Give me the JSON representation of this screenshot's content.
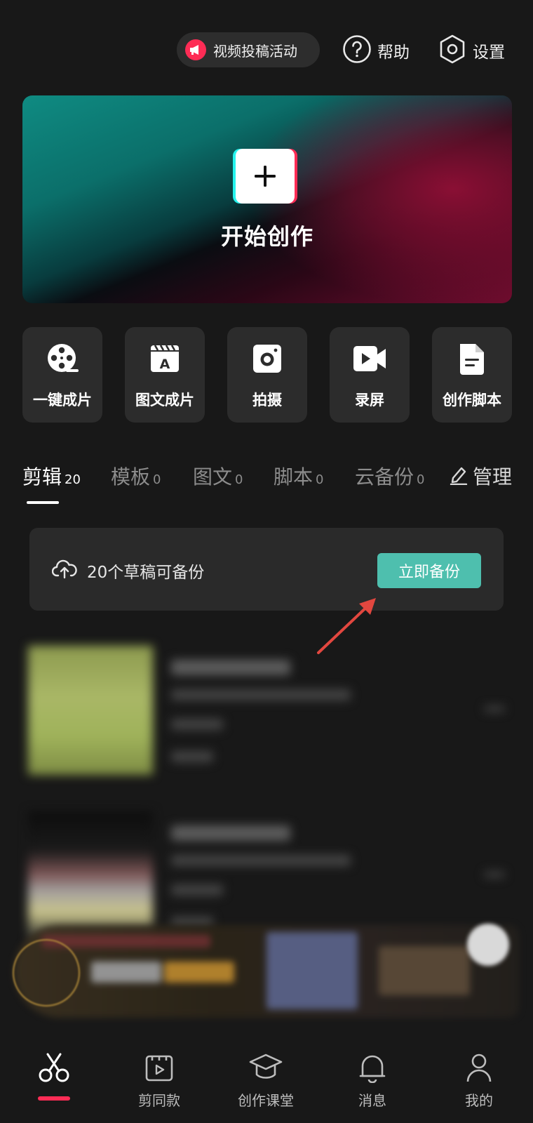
{
  "header": {
    "promo_label": "视频投稿活动",
    "help_label": "帮助",
    "settings_label": "设置"
  },
  "hero": {
    "title": "开始创作"
  },
  "quick_actions": [
    {
      "label": "一键成片",
      "icon": "film-reel-icon"
    },
    {
      "label": "图文成片",
      "icon": "text-clapper-icon"
    },
    {
      "label": "拍摄",
      "icon": "camera-icon"
    },
    {
      "label": "录屏",
      "icon": "video-record-icon"
    },
    {
      "label": "创作脚本",
      "icon": "document-icon"
    }
  ],
  "tabs": [
    {
      "label": "剪辑",
      "count": "20",
      "active": true
    },
    {
      "label": "模板",
      "count": "0"
    },
    {
      "label": "图文",
      "count": "0"
    },
    {
      "label": "脚本",
      "count": "0"
    },
    {
      "label": "云备份",
      "count": "0"
    }
  ],
  "manage_label": "管理",
  "backup": {
    "message": "20个草稿可备份",
    "button_label": "立即备份"
  },
  "bottom_nav": [
    {
      "label": "",
      "icon": "scissors-icon",
      "active": true
    },
    {
      "label": "剪同款",
      "icon": "play-template-icon"
    },
    {
      "label": "创作课堂",
      "icon": "graduation-cap-icon"
    },
    {
      "label": "消息",
      "icon": "bell-icon"
    },
    {
      "label": "我的",
      "icon": "user-icon"
    }
  ],
  "colors": {
    "background": "#181818",
    "accent_teal": "#4ebfae",
    "accent_red": "#fe2c55",
    "card": "#2c2c2c"
  }
}
